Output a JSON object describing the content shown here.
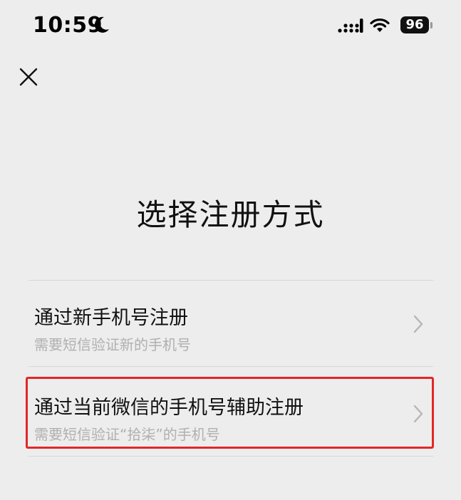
{
  "status_bar": {
    "time": "10:59",
    "battery": "96",
    "icons": [
      "moon-icon",
      "signal-icon",
      "wifi-icon",
      "battery-icon"
    ]
  },
  "header": {
    "close_icon": "close-icon"
  },
  "title": "选择注册方式",
  "options": [
    {
      "title": "通过新手机号注册",
      "subtitle": "需要短信验证新的手机号",
      "icon": "chevron-right-icon"
    },
    {
      "title": "通过当前微信的手机号辅助注册",
      "subtitle": "需要短信验证“拾柒”的手机号",
      "icon": "chevron-right-icon"
    }
  ],
  "colors": {
    "background": "#ededed",
    "highlight_border": "#e32626",
    "subtitle_text": "#b0b0b0",
    "divider": "#d6d6d6"
  }
}
